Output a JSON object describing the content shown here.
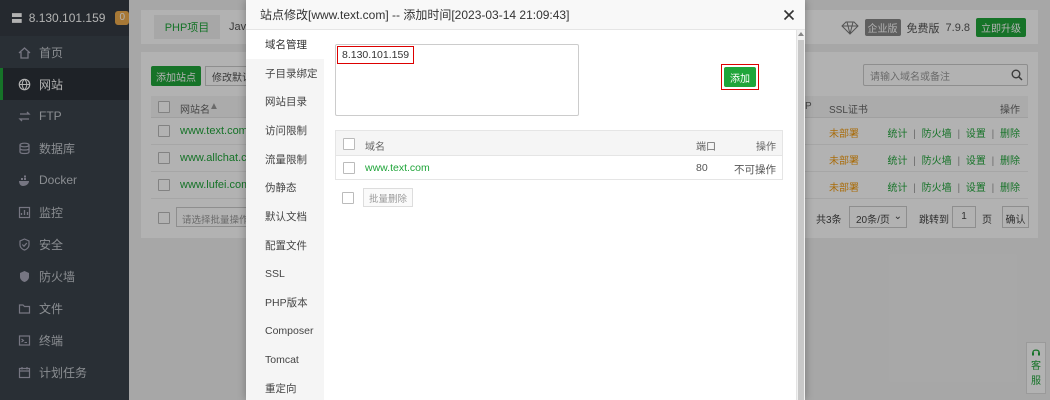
{
  "sidebar": {
    "server_ip": "8.130.101.159",
    "badge": "0",
    "items": [
      {
        "label": "首页",
        "icon": "home-icon"
      },
      {
        "label": "网站",
        "icon": "globe-icon",
        "active": true
      },
      {
        "label": "FTP",
        "icon": "ftp-icon"
      },
      {
        "label": "数据库",
        "icon": "database-icon"
      },
      {
        "label": "Docker",
        "icon": "docker-icon"
      },
      {
        "label": "监控",
        "icon": "monitor-icon"
      },
      {
        "label": "安全",
        "icon": "shield-check-icon"
      },
      {
        "label": "防火墙",
        "icon": "firewall-icon"
      },
      {
        "label": "文件",
        "icon": "folder-icon"
      },
      {
        "label": "终端",
        "icon": "terminal-icon"
      },
      {
        "label": "计划任务",
        "icon": "calendar-icon"
      }
    ]
  },
  "topbar": {
    "tab_php": "PHP项目",
    "tab_java": "Java",
    "edition_tag": "企业版",
    "free_label": "免费版",
    "version": "7.9.8",
    "upgrade": "立即升级"
  },
  "site_panel": {
    "add_site": "添加站点",
    "modify_default": "修改默认",
    "search_placeholder": "请输入域名或备注",
    "col_name": "网站名",
    "col_p": "P",
    "col_ssl": "SSL证书",
    "col_ops": "操作",
    "rows": [
      {
        "name": "www.text.com",
        "ssl": "未部署"
      },
      {
        "name": "www.allchat.com",
        "ssl": "未部署"
      },
      {
        "name": "www.lufei.com",
        "ssl": "未部署"
      }
    ],
    "ops": {
      "stats": "统计",
      "firewall": "防火墙",
      "settings": "设置",
      "delete": "删除",
      "sep": "|"
    },
    "batch_placeholder": "请选择批量操作",
    "pager": {
      "total": "共3条",
      "per_page": "20条/页",
      "jump": "跳转到",
      "page": "1",
      "page_unit": "页",
      "confirm": "确认"
    }
  },
  "modal": {
    "title": "站点修改[www.text.com] -- 添加时间[2023-03-14 21:09:43]",
    "menu": [
      "域名管理",
      "子目录绑定",
      "网站目录",
      "访问限制",
      "流量限制",
      "伪静态",
      "默认文档",
      "配置文件",
      "SSL",
      "PHP版本",
      "Composer",
      "Tomcat",
      "重定向"
    ],
    "domain_input_value": "8.130.101.159",
    "add_button": "添加",
    "table_headers": {
      "domain": "域名",
      "port": "端口",
      "ops": "操作"
    },
    "table_rows": [
      {
        "domain": "www.text.com",
        "port": "80",
        "op": "不可操作"
      }
    ],
    "batch_delete": "批量删除"
  },
  "customer_service": {
    "line1": "客",
    "line2": "服"
  },
  "colors": {
    "accent": "#20a53a",
    "sidebar_bg": "#3c444d",
    "warning": "#f39c12",
    "highlight": "#dd0000"
  }
}
